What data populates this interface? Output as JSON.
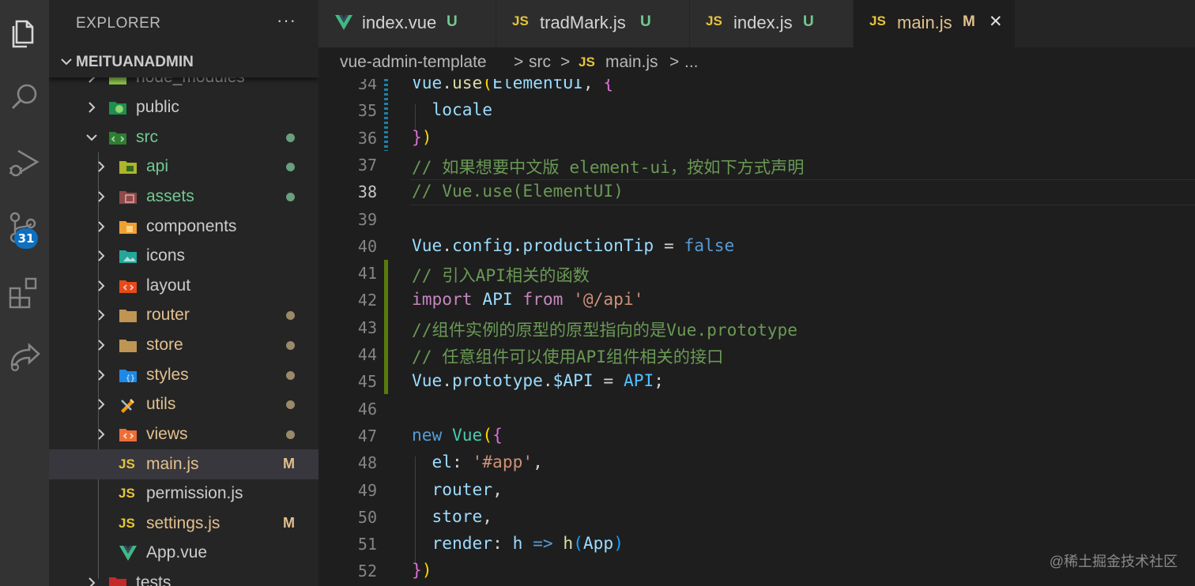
{
  "activity_bar": {
    "icons": [
      "explorer-icon",
      "search-icon",
      "run-debug-icon",
      "source-control-icon",
      "extensions-icon",
      "remote-icon"
    ],
    "source_control_badge": "31",
    "badge_color": "#0e70c0"
  },
  "sidebar": {
    "title": "EXPLORER",
    "more": "···",
    "folder": "MEITUANADMIN",
    "items": [
      {
        "label": "node_modules",
        "icon": "node-folder-icon"
      },
      {
        "label": "public",
        "icon": "public-folder-icon"
      },
      {
        "label": "src",
        "icon": "src-folder-icon"
      },
      {
        "label": "api",
        "icon": "api-folder-icon"
      },
      {
        "label": "assets",
        "icon": "assets-folder-icon"
      },
      {
        "label": "components",
        "icon": "components-folder-icon"
      },
      {
        "label": "icons",
        "icon": "images-folder-icon"
      },
      {
        "label": "layout",
        "icon": "layout-folder-icon"
      },
      {
        "label": "router",
        "icon": "folder-icon"
      },
      {
        "label": "store",
        "icon": "folder-icon"
      },
      {
        "label": "styles",
        "icon": "styles-folder-icon"
      },
      {
        "label": "utils",
        "icon": "utils-folder-icon"
      },
      {
        "label": "views",
        "icon": "views-folder-icon"
      },
      {
        "label": "main.js",
        "icon": "js-file-icon",
        "status": "M"
      },
      {
        "label": "permission.js",
        "icon": "js-file-icon"
      },
      {
        "label": "settings.js",
        "icon": "js-file-icon",
        "status": "M"
      },
      {
        "label": "App.vue",
        "icon": "vue-file-icon"
      },
      {
        "label": "tests",
        "icon": "tests-folder-icon"
      }
    ],
    "js_icon_text": "JS"
  },
  "tabs": [
    {
      "label": "index.vue",
      "status": "U"
    },
    {
      "label": "tradMark.js",
      "status": "U"
    },
    {
      "label": "index.js",
      "status": "U"
    },
    {
      "label": "main.js",
      "status": "M",
      "close": "✕"
    }
  ],
  "breadcrumb": {
    "parts": [
      "vue-admin-template",
      "src",
      "main.js",
      "..."
    ],
    "sep": ">"
  },
  "editor": {
    "current_line": "38",
    "lines": [
      {
        "n": "34",
        "tokens": [
          [
            "t-var",
            "Vue"
          ],
          [
            "",
            "."
          ],
          [
            "t-fn",
            "use"
          ],
          [
            "t-p1",
            "("
          ],
          [
            "t-var",
            "ElementUI"
          ],
          [
            "",
            ", "
          ],
          [
            "t-p2",
            "{"
          ]
        ]
      },
      {
        "n": "35",
        "tokens": [
          [
            "",
            "  "
          ],
          [
            "t-var",
            "locale"
          ]
        ]
      },
      {
        "n": "36",
        "tokens": [
          [
            "t-p2",
            "}"
          ],
          [
            "t-p1",
            ")"
          ]
        ]
      },
      {
        "n": "37",
        "tokens": [
          [
            "t-cm",
            "// 如果想要中文版 element-ui，按如下方式声明"
          ]
        ]
      },
      {
        "n": "38",
        "tokens": [
          [
            "t-cm",
            "// Vue.use(ElementUI)"
          ]
        ]
      },
      {
        "n": "39",
        "tokens": []
      },
      {
        "n": "40",
        "tokens": [
          [
            "t-var",
            "Vue"
          ],
          [
            "",
            "."
          ],
          [
            "t-var",
            "config"
          ],
          [
            "",
            "."
          ],
          [
            "t-var",
            "productionTip"
          ],
          [
            "",
            " = "
          ],
          [
            "t-kw",
            "false"
          ]
        ]
      },
      {
        "n": "41",
        "tokens": [
          [
            "t-cm",
            "// 引入API相关的函数"
          ]
        ]
      },
      {
        "n": "42",
        "tokens": [
          [
            "t-imp",
            "import"
          ],
          [
            "",
            " "
          ],
          [
            "t-var",
            "API"
          ],
          [
            "",
            " "
          ],
          [
            "t-imp",
            "from"
          ],
          [
            "",
            " "
          ],
          [
            "t-str",
            "'@/api'"
          ]
        ]
      },
      {
        "n": "43",
        "tokens": [
          [
            "t-cm",
            "//组件实例的原型的原型指向的是Vue.prototype"
          ]
        ]
      },
      {
        "n": "44",
        "tokens": [
          [
            "t-cm",
            "// 任意组件可以使用API组件相关的接口"
          ]
        ]
      },
      {
        "n": "45",
        "tokens": [
          [
            "t-var",
            "Vue"
          ],
          [
            "",
            "."
          ],
          [
            "t-var",
            "prototype"
          ],
          [
            "",
            "."
          ],
          [
            "t-var",
            "$API"
          ],
          [
            "",
            " = "
          ],
          [
            "t-const",
            "API"
          ],
          [
            "",
            ";"
          ]
        ]
      },
      {
        "n": "46",
        "tokens": []
      },
      {
        "n": "47",
        "tokens": [
          [
            "t-kw",
            "new"
          ],
          [
            "",
            " "
          ],
          [
            "t-cls",
            "Vue"
          ],
          [
            "t-p1",
            "("
          ],
          [
            "t-p2",
            "{"
          ]
        ]
      },
      {
        "n": "48",
        "tokens": [
          [
            "",
            "  "
          ],
          [
            "t-var",
            "el"
          ],
          [
            "",
            ": "
          ],
          [
            "t-str",
            "'#app'"
          ],
          [
            "",
            ","
          ]
        ]
      },
      {
        "n": "49",
        "tokens": [
          [
            "",
            "  "
          ],
          [
            "t-var",
            "router"
          ],
          [
            "",
            ","
          ]
        ]
      },
      {
        "n": "50",
        "tokens": [
          [
            "",
            "  "
          ],
          [
            "t-var",
            "store"
          ],
          [
            "",
            ","
          ]
        ]
      },
      {
        "n": "51",
        "tokens": [
          [
            "",
            "  "
          ],
          [
            "t-var",
            "render"
          ],
          [
            "",
            ": "
          ],
          [
            "t-var",
            "h"
          ],
          [
            "",
            " "
          ],
          [
            "t-kw",
            "=>"
          ],
          [
            "",
            " "
          ],
          [
            "t-fn",
            "h"
          ],
          [
            "t-p3",
            "("
          ],
          [
            "t-var",
            "App"
          ],
          [
            "t-p3",
            ")"
          ]
        ]
      },
      {
        "n": "52",
        "tokens": [
          [
            "t-p2",
            "}"
          ],
          [
            "t-p1",
            ")"
          ]
        ]
      }
    ]
  },
  "watermark": "@稀土掘金技术社区",
  "colors": {
    "modified": "#e2c08d",
    "untracked": "#73c991",
    "git_added_bar": "#587c0c",
    "git_modified_bar": "#1b81a8"
  }
}
